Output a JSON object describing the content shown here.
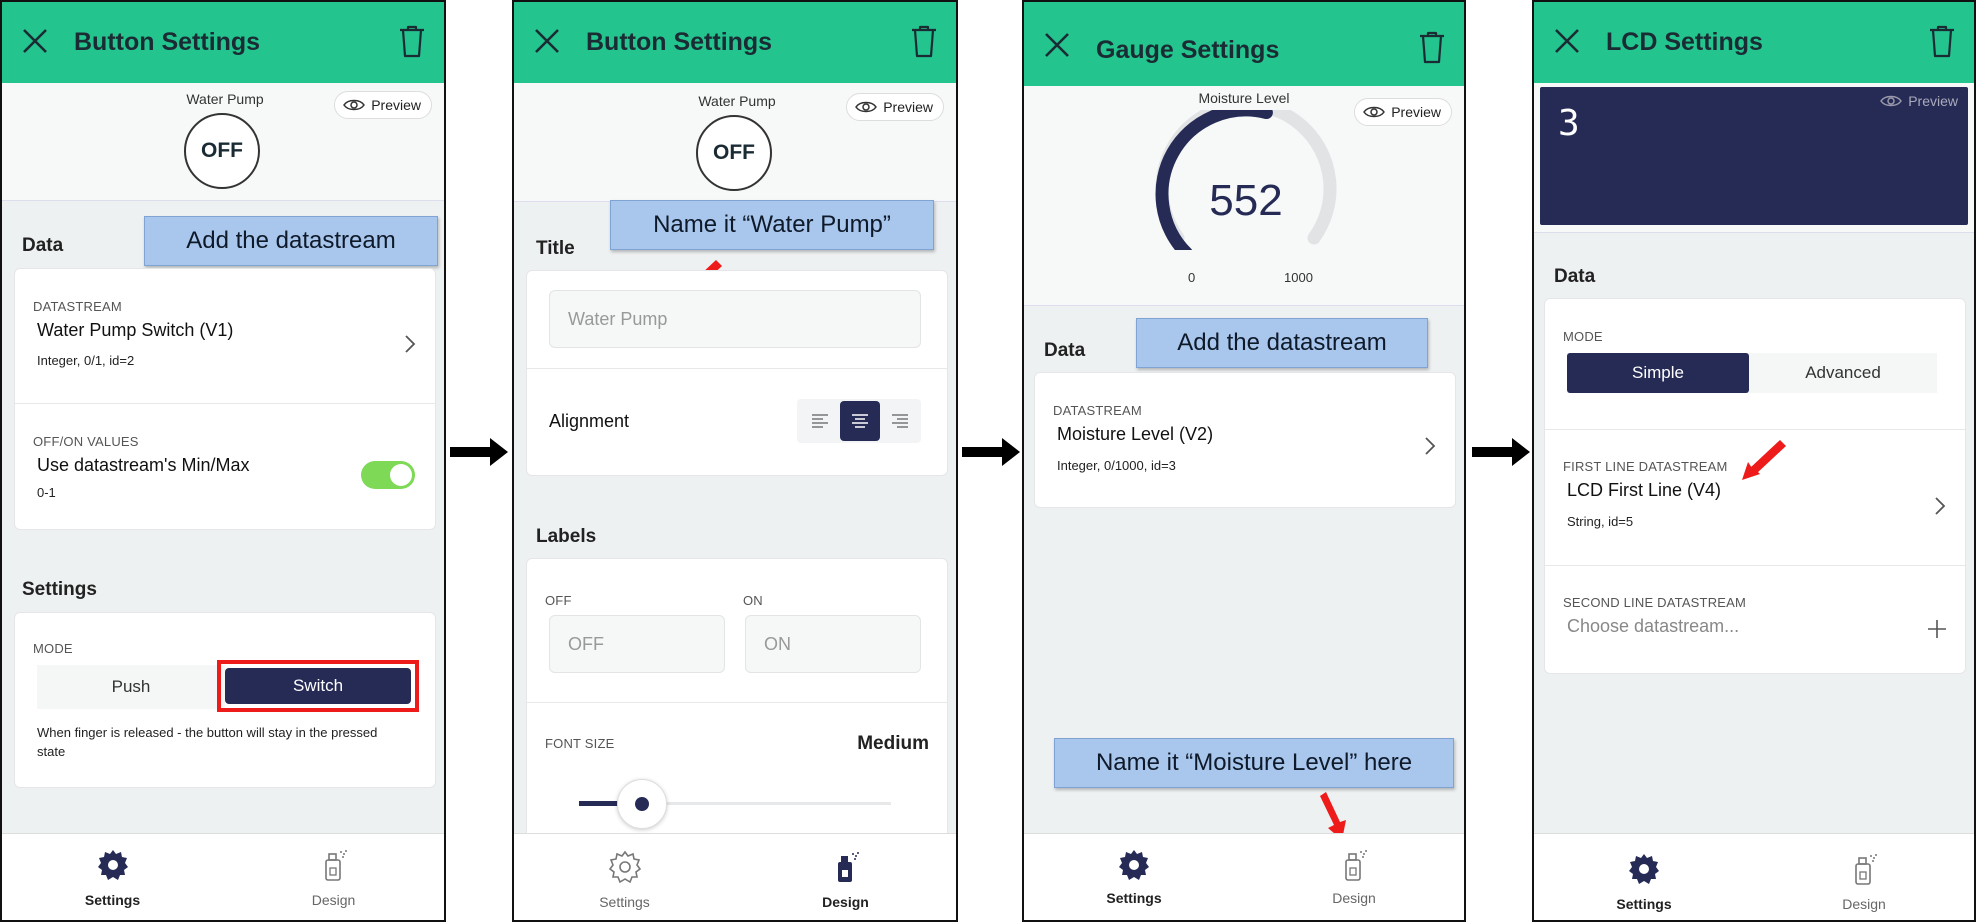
{
  "colors": {
    "header": "#24c48e",
    "navy": "#262b56",
    "callout": "#a9c6ec",
    "red": "#ee1b1b",
    "toggle": "#7ed957"
  },
  "panel1": {
    "title": "Button Settings",
    "widget_label": "Water Pump",
    "button_value": "OFF",
    "preview": "Preview",
    "data_title": "Data",
    "callout": "Add the datastream",
    "datastream_caption": "DATASTREAM",
    "datastream_name": "Water Pump Switch (V1)",
    "datastream_meta": "Integer, 0/1, id=2",
    "offon_caption": "OFF/ON VALUES",
    "offon_text": "Use datastream's Min/Max",
    "offon_range": "0-1",
    "settings_title": "Settings",
    "mode_caption": "MODE",
    "mode_push": "Push",
    "mode_switch": "Switch",
    "mode_help": "When finger is released - the button will stay in the pressed state",
    "tab_settings": "Settings",
    "tab_design": "Design"
  },
  "panel2": {
    "title": "Button Settings",
    "widget_label": "Water Pump",
    "button_value": "OFF",
    "preview": "Preview",
    "callout": "Name it “Water Pump”",
    "title_section": "Title",
    "title_value": "Water Pump",
    "alignment": "Alignment",
    "labels_title": "Labels",
    "off_caption": "OFF",
    "on_caption": "ON",
    "off_placeholder": "OFF",
    "on_placeholder": "ON",
    "font_size_caption": "FONT SIZE",
    "font_size_value": "Medium",
    "font_slider_level": 0.2,
    "tab_settings": "Settings",
    "tab_design": "Design"
  },
  "panel3": {
    "title": "Gauge Settings",
    "widget_label": "Moisture Level",
    "preview": "Preview",
    "gauge_value": "552",
    "gauge_min": "0",
    "gauge_max": "1000",
    "data_title": "Data",
    "callout": "Add the datastream",
    "datastream_caption": "DATASTREAM",
    "datastream_name": "Moisture Level (V2)",
    "datastream_meta": "Integer, 0/1000, id=3",
    "callout2": "Name it “Moisture Level” here",
    "tab_settings": "Settings",
    "tab_design": "Design"
  },
  "panel4": {
    "title": "LCD Settings",
    "preview": "Preview",
    "lcd_text": "3",
    "data_title": "Data",
    "mode_caption": "MODE",
    "mode_simple": "Simple",
    "mode_advanced": "Advanced",
    "first_caption": "FIRST LINE DATASTREAM",
    "first_name": "LCD First Line (V4)",
    "first_meta": "String, id=5",
    "second_caption": "SECOND LINE DATASTREAM",
    "second_placeholder": "Choose datastream...",
    "tab_settings": "Settings",
    "tab_design": "Design"
  }
}
